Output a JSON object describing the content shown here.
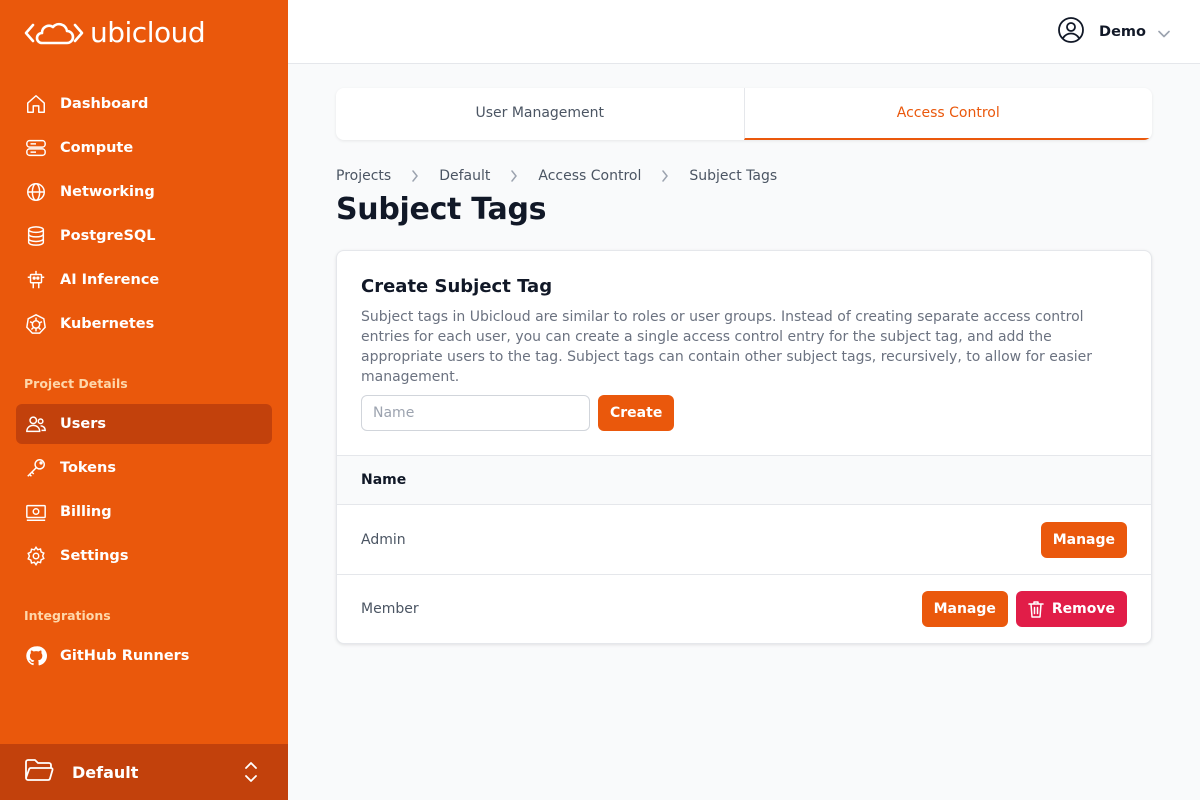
{
  "brand": {
    "name": "ubicloud"
  },
  "sidebar": {
    "main_items": [
      {
        "label": "Dashboard",
        "icon": "home-icon"
      },
      {
        "label": "Compute",
        "icon": "server-icon"
      },
      {
        "label": "Networking",
        "icon": "globe-icon"
      },
      {
        "label": "PostgreSQL",
        "icon": "database-icon"
      },
      {
        "label": "AI Inference",
        "icon": "robot-icon"
      },
      {
        "label": "Kubernetes",
        "icon": "kubernetes-icon"
      }
    ],
    "project_section": "Project Details",
    "project_items": [
      {
        "label": "Users",
        "icon": "users-icon",
        "active": true
      },
      {
        "label": "Tokens",
        "icon": "key-icon"
      },
      {
        "label": "Billing",
        "icon": "billing-icon"
      },
      {
        "label": "Settings",
        "icon": "gear-icon"
      }
    ],
    "integrations_section": "Integrations",
    "integration_items": [
      {
        "label": "GitHub Runners",
        "icon": "github-icon"
      }
    ],
    "project_switcher": {
      "label": "Default",
      "icon": "folder-icon"
    }
  },
  "topbar": {
    "user_name": "Demo"
  },
  "tabs": [
    {
      "label": "User Management",
      "active": false
    },
    {
      "label": "Access Control",
      "active": true
    }
  ],
  "breadcrumb": [
    "Projects",
    "Default",
    "Access Control",
    "Subject Tags"
  ],
  "page_title": "Subject Tags",
  "create_card": {
    "title": "Create Subject Tag",
    "description": "Subject tags in Ubicloud are similar to roles or user groups. Instead of creating separate access control entries for each user, you can create a single access control entry for the subject tag, and add the appropriate users to the tag. Subject tags can contain other subject tags, recursively, to allow for easier management.",
    "name_placeholder": "Name",
    "name_value": "",
    "create_label": "Create"
  },
  "table": {
    "header": "Name",
    "rows": [
      {
        "name": "Admin",
        "manage_label": "Manage"
      },
      {
        "name": "Member",
        "manage_label": "Manage",
        "remove_label": "Remove"
      }
    ]
  },
  "colors": {
    "brand": "#ea580c",
    "brand_dark": "#c2410c",
    "danger": "#e11d48"
  }
}
